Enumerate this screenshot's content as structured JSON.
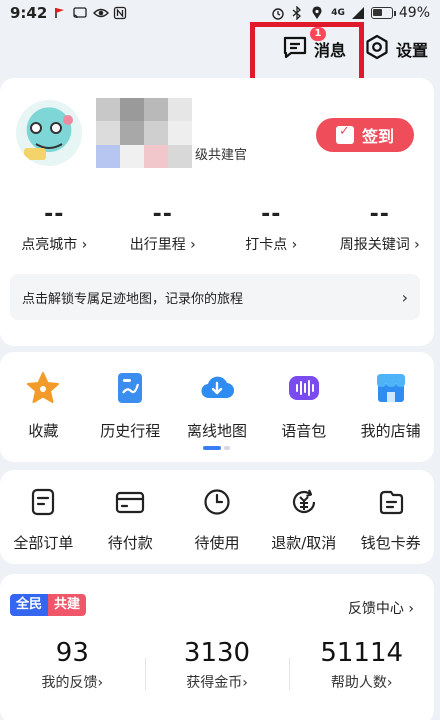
{
  "status_bar": {
    "time": "9:42",
    "network": "4G",
    "battery": "49%"
  },
  "top": {
    "messages_label": "消息",
    "messages_badge": "1",
    "settings_label": "设置"
  },
  "profile": {
    "level": "级共建官",
    "checkin_label": "签到",
    "stats": [
      {
        "value": "--",
        "label": "点亮城市"
      },
      {
        "value": "--",
        "label": "出行里程"
      },
      {
        "value": "--",
        "label": "打卡点"
      },
      {
        "value": "--",
        "label": "周报关键词"
      }
    ],
    "unlock_text": "点击解锁专属足迹地图，记录你的旅程"
  },
  "tools": [
    {
      "label": "收藏",
      "icon": "star-icon"
    },
    {
      "label": "历史行程",
      "icon": "history-icon"
    },
    {
      "label": "离线地图",
      "icon": "cloud-download-icon"
    },
    {
      "label": "语音包",
      "icon": "voice-icon"
    },
    {
      "label": "我的店铺",
      "icon": "shop-icon"
    }
  ],
  "orders": [
    {
      "label": "全部订单",
      "icon": "orders-icon"
    },
    {
      "label": "待付款",
      "icon": "card-icon"
    },
    {
      "label": "待使用",
      "icon": "clock-icon"
    },
    {
      "label": "退款/取消",
      "icon": "refund-icon"
    },
    {
      "label": "钱包卡券",
      "icon": "wallet-icon"
    }
  ],
  "feedback": {
    "tag_part1": "全民",
    "tag_part2": "共建",
    "center_label": "反馈中心",
    "stats": [
      {
        "value": "93",
        "label": "我的反馈"
      },
      {
        "value": "3130",
        "label": "获得金币"
      },
      {
        "value": "51114",
        "label": "帮助人数"
      }
    ]
  },
  "colors": {
    "accent_red": "#ef4d5a",
    "highlight_red": "#e01a2c",
    "blue": "#3b7cf6",
    "purple": "#7a4cf0",
    "star_orange": "#f29b2a"
  }
}
